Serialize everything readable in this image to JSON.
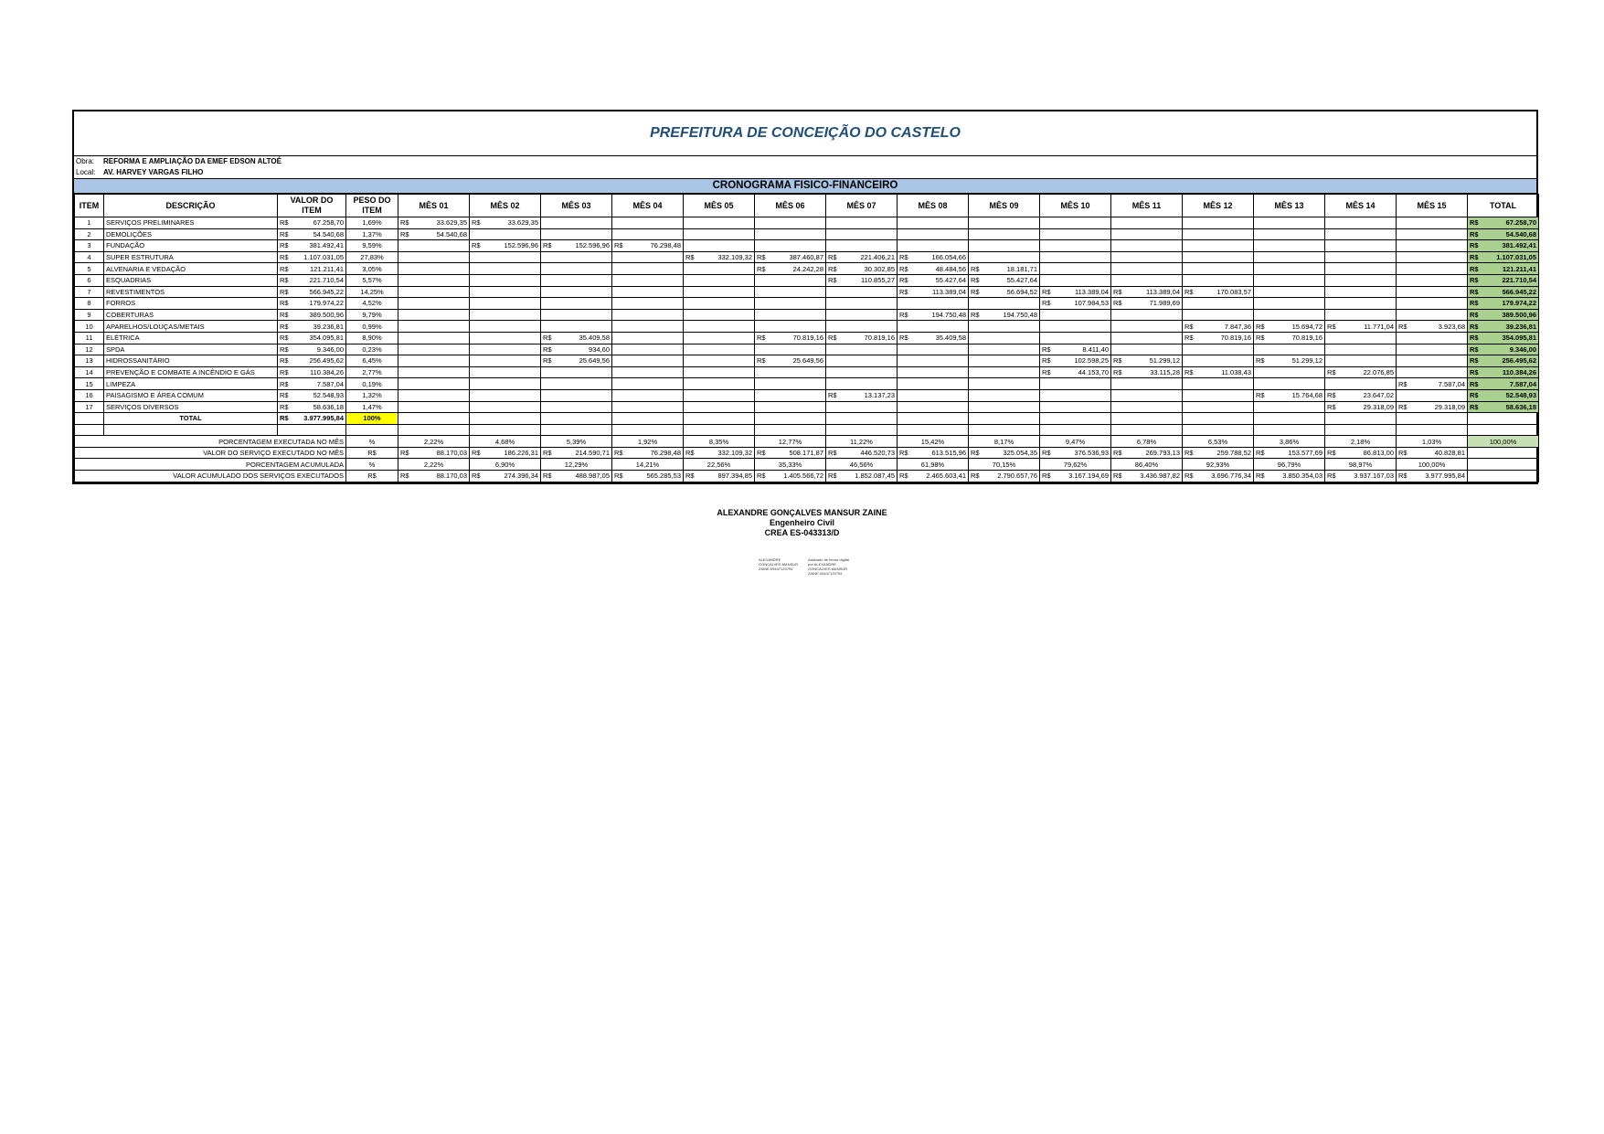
{
  "header": {
    "title": "PREFEITURA DE CONCEIÇÃO DO CASTELO",
    "obra_label": "Obra:",
    "obra_value": "REFORMA E AMPLIAÇÃO DA EMEF EDSON ALTOÉ",
    "local_label": "Local:",
    "local_value": "AV. HARVEY VARGAS FILHO",
    "section_title": "CRONOGRAMA FISICO-FINANCEIRO"
  },
  "columns": {
    "item": "ITEM",
    "descricao": "DESCRIÇÃO",
    "valor": "VALOR DO ITEM",
    "peso": "PESO DO ITEM",
    "months": [
      "MÊS 01",
      "MÊS 02",
      "MÊS 03",
      "MÊS 04",
      "MÊS 05",
      "MÊS 06",
      "MÊS 07",
      "MÊS 08",
      "MÊS 09",
      "MÊS 10",
      "MÊS 11",
      "MÊS 12",
      "MÊS 13",
      "MÊS 14",
      "MÊS 15"
    ],
    "total": "TOTAL"
  },
  "currency": "R$",
  "rows": [
    {
      "item": "1",
      "desc": "SERVIÇOS PRELIMINARES",
      "valor": "67.258,70",
      "peso": "1,69%",
      "months": [
        "33.629,35",
        "33.629,35",
        "",
        "",
        "",
        "",
        "",
        "",
        "",
        "",
        "",
        "",
        "",
        "",
        ""
      ],
      "total": "67.258,70"
    },
    {
      "item": "2",
      "desc": "DEMOLIÇÕES",
      "valor": "54.540,68",
      "peso": "1,37%",
      "months": [
        "54.540,68",
        "",
        "",
        "",
        "",
        "",
        "",
        "",
        "",
        "",
        "",
        "",
        "",
        "",
        ""
      ],
      "total": "54.540,68"
    },
    {
      "item": "3",
      "desc": "FUNDAÇÃO",
      "valor": "381.492,41",
      "peso": "9,59%",
      "months": [
        "",
        "152.596,96",
        "152.596,96",
        "76.298,48",
        "",
        "",
        "",
        "",
        "",
        "",
        "",
        "",
        "",
        "",
        ""
      ],
      "total": "381.492,41"
    },
    {
      "item": "4",
      "desc": "SUPER ESTRUTURA",
      "valor": "1.107.031,05",
      "peso": "27,83%",
      "months": [
        "",
        "",
        "",
        "",
        "332.109,32",
        "387.460,87",
        "221.406,21",
        "166.054,66",
        "",
        "",
        "",
        "",
        "",
        "",
        ""
      ],
      "total": "1.107.031,05"
    },
    {
      "item": "5",
      "desc": "ALVENARIA E VEDAÇÃO",
      "valor": "121.211,41",
      "peso": "3,05%",
      "months": [
        "",
        "",
        "",
        "",
        "",
        "24.242,28",
        "30.302,85",
        "48.484,56",
        "18.181,71",
        "",
        "",
        "",
        "",
        "",
        ""
      ],
      "total": "121.211,41"
    },
    {
      "item": "6",
      "desc": "ESQUADRIAS",
      "valor": "221.710,54",
      "peso": "5,57%",
      "months": [
        "",
        "",
        "",
        "",
        "",
        "",
        "110.855,27",
        "55.427,64",
        "55.427,64",
        "",
        "",
        "",
        "",
        "",
        ""
      ],
      "total": "221.710,54"
    },
    {
      "item": "7",
      "desc": "REVESTIMENTOS",
      "valor": "566.945,22",
      "peso": "14,25%",
      "months": [
        "",
        "",
        "",
        "",
        "",
        "",
        "",
        "113.389,04",
        "56.694,52",
        "113.389,04",
        "113.389,04",
        "170.083,57",
        "",
        "",
        ""
      ],
      "total": "566.945,22"
    },
    {
      "item": "8",
      "desc": "FORROS",
      "valor": "179.974,22",
      "peso": "4,52%",
      "months": [
        "",
        "",
        "",
        "",
        "",
        "",
        "",
        "",
        "",
        "107.984,53",
        "71.989,69",
        "",
        "",
        "",
        ""
      ],
      "total": "179.974,22"
    },
    {
      "item": "9",
      "desc": "COBERTURAS",
      "valor": "389.500,96",
      "peso": "9,79%",
      "months": [
        "",
        "",
        "",
        "",
        "",
        "",
        "",
        "194.750,48",
        "194.750,48",
        "",
        "",
        "",
        "",
        "",
        ""
      ],
      "total": "389.500,96"
    },
    {
      "item": "10",
      "desc": "APARELHOS/LOUÇAS/METAIS",
      "valor": "39.236,81",
      "peso": "0,99%",
      "months": [
        "",
        "",
        "",
        "",
        "",
        "",
        "",
        "",
        "",
        "",
        "",
        "7.847,36",
        "15.694,72",
        "11.771,04",
        "3.923,68"
      ],
      "total": "39.236,81"
    },
    {
      "item": "11",
      "desc": "ELÉTRICA",
      "valor": "354.095,81",
      "peso": "8,90%",
      "months": [
        "",
        "",
        "35.409,58",
        "",
        "",
        "70.819,16",
        "70.819,16",
        "35.409,58",
        "",
        "",
        "",
        "70.819,16",
        "70.819,16",
        "",
        ""
      ],
      "total": "354.095,81"
    },
    {
      "item": "12",
      "desc": "SPDA",
      "valor": "9.346,00",
      "peso": "0,23%",
      "months": [
        "",
        "",
        "934,60",
        "",
        "",
        "",
        "",
        "",
        "",
        "8.411,40",
        "",
        "",
        "",
        "",
        ""
      ],
      "total": "9.346,00"
    },
    {
      "item": "13",
      "desc": "HIDROSSANITÁRIO",
      "valor": "256.495,62",
      "peso": "6,45%",
      "months": [
        "",
        "",
        "25.649,56",
        "",
        "",
        "25.649,56",
        "",
        "",
        "",
        "102.598,25",
        "51.299,12",
        "",
        "51.299,12",
        "",
        ""
      ],
      "total": "256.495,62"
    },
    {
      "item": "14",
      "desc": "PREVENÇÃO E COMBATE A INCÊNDIO E GÁS",
      "valor": "110.384,26",
      "peso": "2,77%",
      "months": [
        "",
        "",
        "",
        "",
        "",
        "",
        "",
        "",
        "",
        "44.153,70",
        "33.115,28",
        "11.038,43",
        "",
        "22.076,85",
        ""
      ],
      "total": "110.384,26"
    },
    {
      "item": "15",
      "desc": "LIMPEZA",
      "valor": "7.587,04",
      "peso": "0,19%",
      "months": [
        "",
        "",
        "",
        "",
        "",
        "",
        "",
        "",
        "",
        "",
        "",
        "",
        "",
        "",
        "7.587,04"
      ],
      "total": "7.587,04"
    },
    {
      "item": "16",
      "desc": "PAISAGISMO E ÁREA COMUM",
      "valor": "52.548,93",
      "peso": "1,32%",
      "months": [
        "",
        "",
        "",
        "",
        "",
        "",
        "13.137,23",
        "",
        "",
        "",
        "",
        "",
        "15.764,68",
        "23.647,02",
        ""
      ],
      "total": "52.548,93"
    },
    {
      "item": "17",
      "desc": "SERVIÇOS DIVERSOS",
      "valor": "58.636,18",
      "peso": "1,47%",
      "months": [
        "",
        "",
        "",
        "",
        "",
        "",
        "",
        "",
        "",
        "",
        "",
        "",
        "",
        "29.318,09",
        "29.318,09"
      ],
      "total": "58.636,18"
    }
  ],
  "total_row": {
    "label": "TOTAL",
    "valor": "3.977.995,84",
    "peso": "100%"
  },
  "summary": {
    "pct_label": "PORCENTAGEM EXECUTADA NO MÊS",
    "pct_unit": "%",
    "pct": [
      "2,22%",
      "4,68%",
      "5,39%",
      "1,92%",
      "8,35%",
      "12,77%",
      "11,22%",
      "15,42%",
      "8,17%",
      "9,47%",
      "6,78%",
      "6,53%",
      "3,86%",
      "2,18%",
      "1,03%"
    ],
    "pct_total": "100,00%",
    "val_label": "VALOR DO SERVIÇO EXECUTADO NO MÊS",
    "val_unit": "R$",
    "val": [
      "88.170,03",
      "186.226,31",
      "214.590,71",
      "76.298,48",
      "332.109,32",
      "508.171,87",
      "446.520,73",
      "613.515,96",
      "325.054,35",
      "376.536,93",
      "269.793,13",
      "259.788,52",
      "153.577,69",
      "86.813,00",
      "40.828,81"
    ],
    "acc_pct_label": "PORCENTAGEM ACUMULADA",
    "acc_pct_unit": "%",
    "acc_pct": [
      "2,22%",
      "6,90%",
      "12,29%",
      "14,21%",
      "22,56%",
      "35,33%",
      "46,56%",
      "61,98%",
      "70,15%",
      "79,62%",
      "86,40%",
      "92,93%",
      "96,79%",
      "98,97%",
      "100,00%"
    ],
    "acc_val_label": "VALOR ACUMULADO DOS SERVIÇOS EXECUTADOS",
    "acc_val_unit": "R$",
    "acc_val": [
      "88.170,03",
      "274.396,34",
      "488.987,05",
      "565.285,53",
      "897.394,85",
      "1.405.566,72",
      "1.852.087,45",
      "2.465.603,41",
      "2.790.657,76",
      "3.167.194,69",
      "3.436.987,82",
      "3.696.776,34",
      "3.850.354,03",
      "3.937.167,03",
      "3.977.995,84"
    ]
  },
  "signature": {
    "name": "ALEXANDRE GONÇALVES MANSUR ZAINE",
    "role": "Engenheiro Civil",
    "crea": "CREA ES-043313/D",
    "digital_left": "ALEXANDRE GONCALVES MANSUR ZAINE:09447125794",
    "digital_right": "Assinado de forma digital por ALEXANDRE GONCALVES MANSUR ZAINE:09447125794"
  },
  "colors": {
    "header_blue": "#a9c4e4",
    "title_blue": "#1f4e79",
    "total_green": "#a9d08e",
    "highlight_yellow": "#ffff00"
  }
}
